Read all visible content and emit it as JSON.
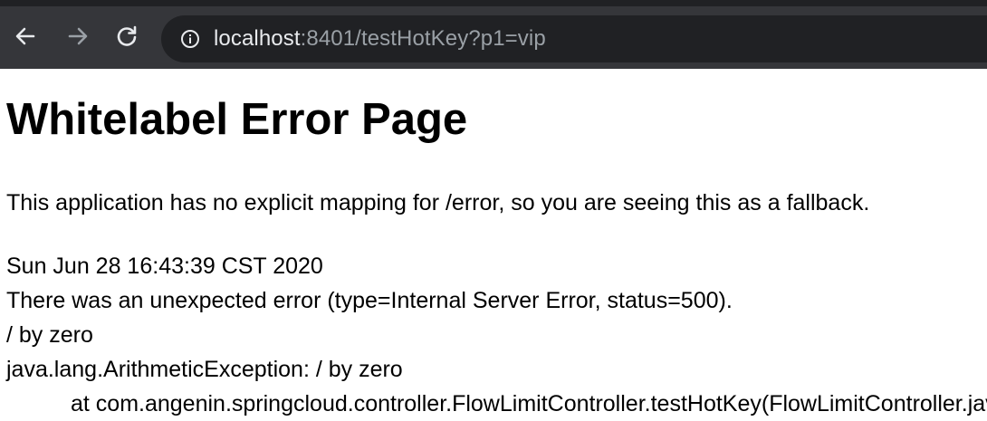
{
  "browser": {
    "url_host": "localhost",
    "url_rest": ":8401/testHotKey?p1=vip",
    "icons": {
      "back": "arrow-left-icon",
      "forward": "arrow-right-icon",
      "reload": "reload-icon",
      "site_info": "info-circle-icon"
    }
  },
  "page": {
    "title": "Whitelabel Error Page",
    "message": "This application has no explicit mapping for /error, so you are seeing this as a fallback.",
    "timestamp": "Sun Jun 28 16:43:39 CST 2020",
    "error_summary": "There was an unexpected error (type=Internal Server Error, status=500).",
    "error_message": "/ by zero",
    "exception": "java.lang.ArithmeticException: / by zero",
    "stack_line": "at com.angenin.springcloud.controller.FlowLimitController.testHotKey(FlowLimitController.java)"
  },
  "colors": {
    "toolbar_bg": "#35363a",
    "omnibox_bg": "#202124",
    "url_host": "#e8eaed",
    "url_path": "#9aa0a6"
  }
}
